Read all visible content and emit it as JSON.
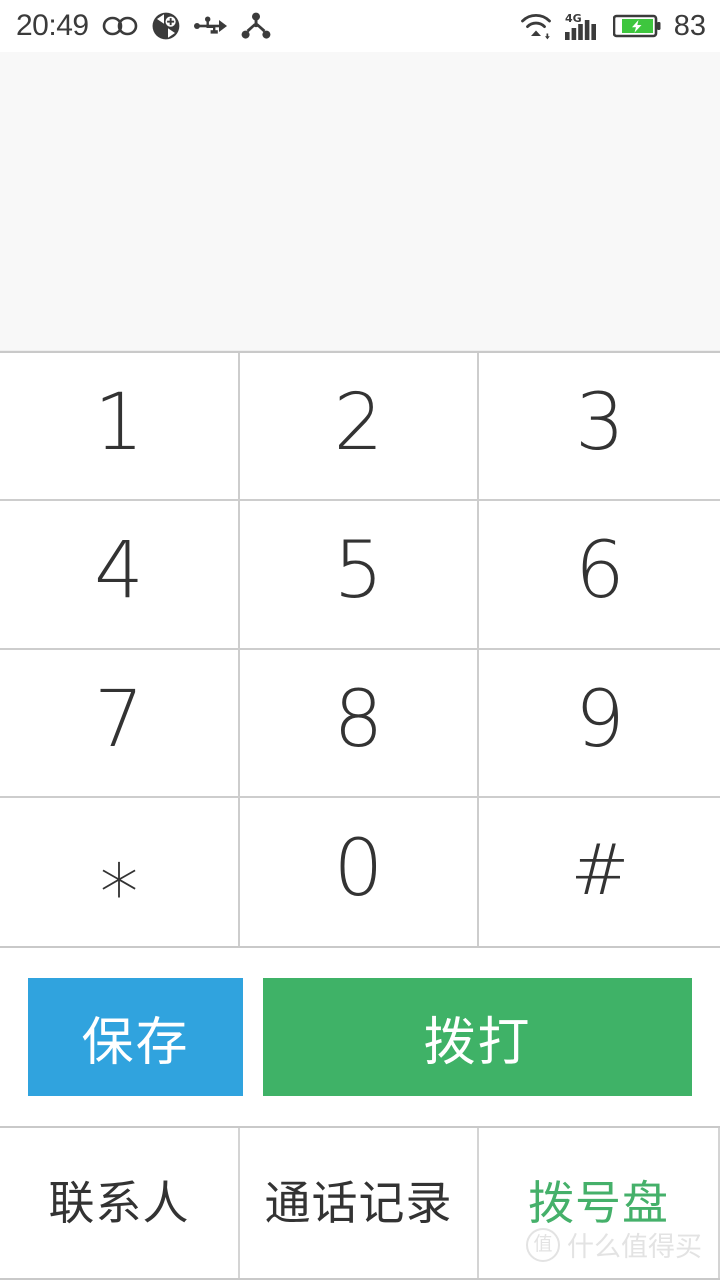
{
  "status_bar": {
    "time": "20:49",
    "battery_percent": "83",
    "left_icons": [
      {
        "name": "infinity-icon",
        "label": "∞"
      },
      {
        "name": "sync-add-icon",
        "label": "sync"
      },
      {
        "name": "usb-icon",
        "label": "usb"
      },
      {
        "name": "share-node-icon",
        "label": "share"
      }
    ],
    "right_icons": [
      {
        "name": "wifi-icon",
        "label": "wifi"
      },
      {
        "name": "cellular-signal-4g-icon",
        "label": "4G"
      },
      {
        "name": "battery-charging-icon",
        "label": "charging"
      }
    ],
    "network_type": "4G",
    "colors": {
      "text": "#3b3b3b",
      "battery_fill": "#3ec63e"
    }
  },
  "display": {
    "number": "",
    "placeholder": ""
  },
  "keypad": {
    "keys": [
      {
        "label": "1",
        "name": "key-1"
      },
      {
        "label": "2",
        "name": "key-2"
      },
      {
        "label": "3",
        "name": "key-3"
      },
      {
        "label": "4",
        "name": "key-4"
      },
      {
        "label": "5",
        "name": "key-5"
      },
      {
        "label": "6",
        "name": "key-6"
      },
      {
        "label": "7",
        "name": "key-7"
      },
      {
        "label": "8",
        "name": "key-8"
      },
      {
        "label": "9",
        "name": "key-9"
      },
      {
        "label": "∗",
        "name": "key-star"
      },
      {
        "label": "0",
        "name": "key-0"
      },
      {
        "label": "#",
        "name": "key-hash"
      }
    ]
  },
  "actions": {
    "save_label": "保存",
    "dial_label": "拨打",
    "save_color": "#30a3de",
    "dial_color": "#3fb267"
  },
  "tabbar": {
    "tabs": [
      {
        "label": "联系人",
        "name": "tab-contacts",
        "active": false
      },
      {
        "label": "通话记录",
        "name": "tab-call-log",
        "active": false
      },
      {
        "label": "拨号盘",
        "name": "tab-dialpad",
        "active": true
      }
    ],
    "active_color": "#45b06a"
  },
  "watermark": {
    "badge": "值",
    "text": "什么值得买"
  }
}
